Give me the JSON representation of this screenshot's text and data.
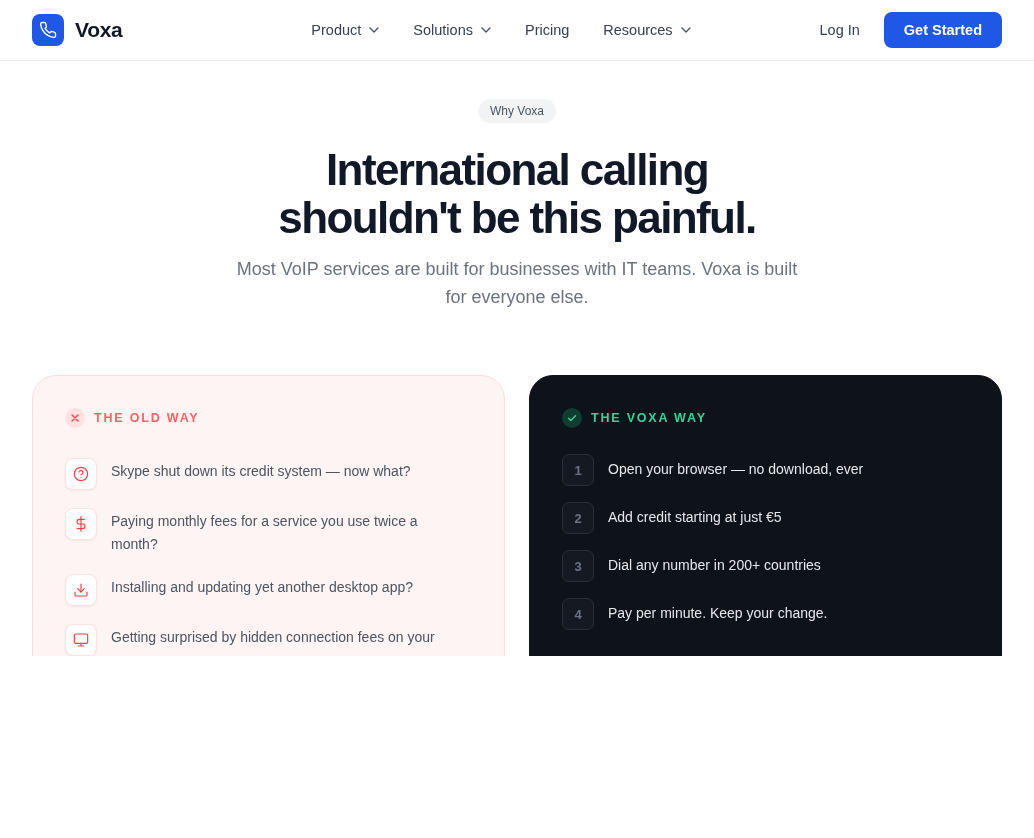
{
  "nav": {
    "brand": "Voxa",
    "links": [
      {
        "label": "Product",
        "dropdown": true
      },
      {
        "label": "Solutions",
        "dropdown": true
      },
      {
        "label": "Pricing",
        "dropdown": false
      },
      {
        "label": "Resources",
        "dropdown": true
      }
    ],
    "login": "Log In",
    "cta": "Get Started"
  },
  "hero": {
    "badge": "Why Voxa",
    "title_lines": [
      "International calling",
      "shouldn't be this painful."
    ],
    "subtitle": "Most VoIP services are built for businesses with IT teams. Voxa is built for everyone else."
  },
  "comparison": [
    {
      "kind": "old",
      "title": "THE OLD WAY",
      "items": [
        {
          "text": "Skype shut down its credit system — now what?"
        },
        {
          "text": "Paying monthly fees for a service you use twice a month?"
        },
        {
          "text": "Installing and updating yet another desktop app?"
        },
        {
          "text": "Getting surprised by hidden connection fees on your"
        }
      ]
    },
    {
      "kind": "new",
      "title": "THE VOXA WAY",
      "items": [
        {
          "number": "1",
          "text": "Open your browser — no download, ever"
        },
        {
          "number": "2",
          "text": "Add credit starting at just €5"
        },
        {
          "number": "3",
          "text": "Dial any number in 200+ countries"
        },
        {
          "number": "4",
          "text": "Pay per minute. Keep your change."
        }
      ]
    }
  ]
}
